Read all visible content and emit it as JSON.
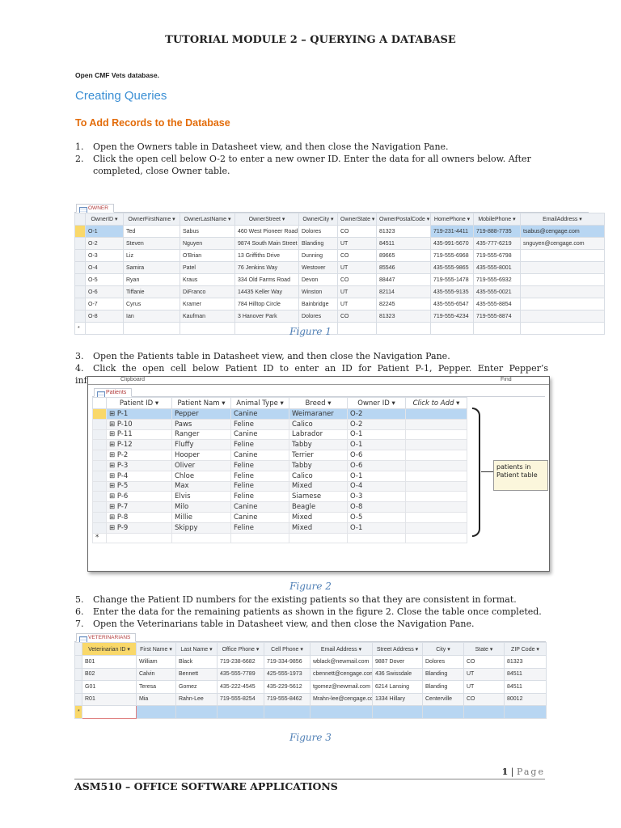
{
  "header": {
    "title": "TUTORIAL MODULE 2 – QUERYING A DATABASE"
  },
  "intro": "Open CMF Vets database.",
  "heading": "Creating Queries",
  "subheading": "To Add Records to the Database",
  "steps": [
    {
      "n": "1.",
      "text": "Open the Owners table in Datasheet view, and then close the Navigation Pane."
    },
    {
      "n": "2.",
      "text": "Click the open cell below O-2 to enter a new owner ID. Enter the data for all owners below. After",
      "cont": "completed, close Owner table."
    },
    {
      "n": "3.",
      "text": "Open the Patients table in Datasheet view, and then close the Navigation Pane."
    },
    {
      "n": "4.",
      "text": "Click the open cell below Patient ID to enter an ID for Patient P-1, Pepper. Enter Pepper’s information."
    },
    {
      "n": "5.",
      "text": "Change the Patient ID numbers for the existing patients so that they are consistent in format."
    },
    {
      "n": "6.",
      "text": "Enter the data for the remaining patients as shown in the figure 2. Close the table once completed."
    },
    {
      "n": "7.",
      "text": "Open the Veterinarians table in Datasheet view, and then close the Navigation Pane."
    }
  ],
  "figures": [
    "Figure 1",
    "Figure 2",
    "Figure 3"
  ],
  "owner": {
    "tab": "OWNER",
    "columns": [
      "OwnerID",
      "OwnerFirstName",
      "OwnerLastName",
      "OwnerStreet",
      "OwnerCity",
      "OwnerState",
      "OwnerPostalCode",
      "HomePhone",
      "MobilePhone",
      "EmailAddress"
    ],
    "rows": [
      [
        "O-1",
        "Ted",
        "Sabus",
        "460 West Pioneer Road",
        "Dolores",
        "CO",
        "81323",
        "719-231-4411",
        "719-888-7735",
        "tsabus@cengage.com"
      ],
      [
        "O-2",
        "Steven",
        "Nguyen",
        "9874 South Main Street",
        "Blanding",
        "UT",
        "84511",
        "435-991-5670",
        "435-777-6219",
        "snguyen@cengage.com"
      ],
      [
        "O-3",
        "Liz",
        "O'Brian",
        "13 Griffiths Drive",
        "Dunning",
        "CO",
        "89665",
        "719-555-6968",
        "719-555-6798",
        ""
      ],
      [
        "O-4",
        "Samira",
        "Patel",
        "76 Jenkins Way",
        "Westover",
        "UT",
        "85546",
        "435-555-9865",
        "435-555-8001",
        ""
      ],
      [
        "O-5",
        "Ryan",
        "Kraus",
        "334 Old Farms Road",
        "Devon",
        "CO",
        "88447",
        "719-555-1478",
        "719-555-6932",
        ""
      ],
      [
        "O-6",
        "Tiffanie",
        "DiFranco",
        "14435 Keller Way",
        "Winston",
        "UT",
        "82114",
        "435-555-9135",
        "435-555-0021",
        ""
      ],
      [
        "O-7",
        "Cyrus",
        "Kramer",
        "784 Hilltop Circle",
        "Bainbridge",
        "UT",
        "82245",
        "435-555-6547",
        "435-555-8854",
        ""
      ],
      [
        "O-8",
        "Ian",
        "Kaufman",
        "3 Hanover Park",
        "Dolores",
        "CO",
        "81323",
        "719-555-4234",
        "719-555-8874",
        ""
      ]
    ]
  },
  "patients": {
    "tab": "Patients",
    "ribbon_left": "Clipboard",
    "ribbon_right": "Find",
    "columns": [
      "Patient ID",
      "Patient Nam",
      "Animal Type",
      "Breed",
      "Owner ID",
      "Click to Add"
    ],
    "rows": [
      [
        "P-1",
        "Pepper",
        "Canine",
        "Weimaraner",
        "O-2"
      ],
      [
        "P-10",
        "Paws",
        "Feline",
        "Calico",
        "O-2"
      ],
      [
        "P-11",
        "Ranger",
        "Canine",
        "Labrador",
        "O-1"
      ],
      [
        "P-12",
        "Fluffy",
        "Feline",
        "Tabby",
        "O-1"
      ],
      [
        "P-2",
        "Hooper",
        "Canine",
        "Terrier",
        "O-6"
      ],
      [
        "P-3",
        "Oliver",
        "Feline",
        "Tabby",
        "O-6"
      ],
      [
        "P-4",
        "Chloe",
        "Feline",
        "Calico",
        "O-1"
      ],
      [
        "P-5",
        "Max",
        "Feline",
        "Mixed",
        "O-4"
      ],
      [
        "P-6",
        "Elvis",
        "Feline",
        "Siamese",
        "O-3"
      ],
      [
        "P-7",
        "Milo",
        "Canine",
        "Beagle",
        "O-8"
      ],
      [
        "P-8",
        "Millie",
        "Canine",
        "Mixed",
        "O-5"
      ],
      [
        "P-9",
        "Skippy",
        "Feline",
        "Mixed",
        "O-1"
      ]
    ],
    "callout": "patients in Patient table"
  },
  "vets": {
    "tab": "VETERINARIANS",
    "columns": [
      "Veterinarian ID",
      "First Name",
      "Last Name",
      "Office Phone",
      "Cell Phone",
      "Email Address",
      "Street Address",
      "City",
      "State",
      "ZIP Code"
    ],
    "rows": [
      [
        "B01",
        "William",
        "Black",
        "719-238-6682",
        "719-334-9856",
        "wblack@newmail.com",
        "9887 Dover",
        "Dolores",
        "CO",
        "81323"
      ],
      [
        "B02",
        "Calvin",
        "Bennett",
        "435-555-7789",
        "425-555-1973",
        "cbennett@cengage.com",
        "436 Swissdale",
        "Blanding",
        "UT",
        "84511"
      ],
      [
        "G01",
        "Teresa",
        "Gomez",
        "435-222-4545",
        "435-229-5612",
        "tgomez@newmail.com",
        "6214 Lansing",
        "Blanding",
        "UT",
        "84511"
      ],
      [
        "R01",
        "Mia",
        "Rahn-Lee",
        "719-555-8254",
        "719-555-8462",
        "Mrahn-lee@cengage.com",
        "1334 Hillary",
        "Centerville",
        "CO",
        "80012"
      ]
    ]
  },
  "footer": {
    "page_num": "1",
    "page_label": "Page",
    "course": "ASM510 – OFFICE SOFTWARE APPLICATIONS"
  }
}
